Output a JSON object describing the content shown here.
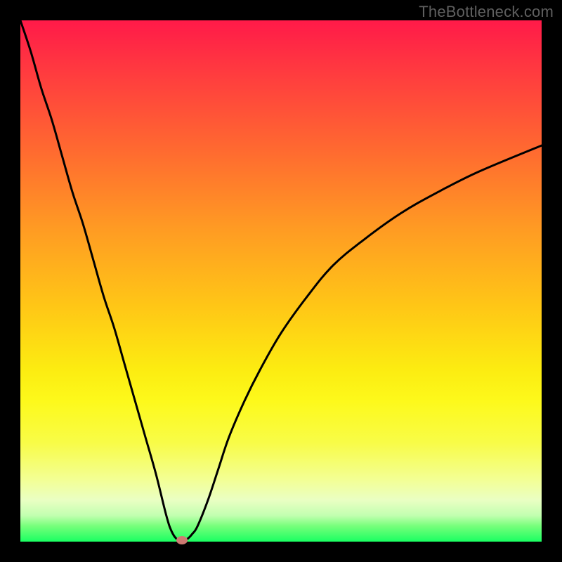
{
  "watermark": "TheBottleneck.com",
  "chart_data": {
    "type": "line",
    "title": "",
    "xlabel": "",
    "ylabel": "",
    "xlim": [
      0,
      100
    ],
    "ylim": [
      0,
      100
    ],
    "grid": false,
    "series": [
      {
        "name": "bottleneck-curve",
        "x": [
          0,
          2,
          4,
          6,
          8,
          10,
          12,
          14,
          16,
          18,
          20,
          22,
          24,
          26,
          28,
          29,
          30,
          31,
          32,
          33,
          34,
          36,
          38,
          40,
          43,
          46,
          50,
          55,
          60,
          66,
          73,
          80,
          88,
          100
        ],
        "values": [
          100,
          94,
          87,
          81,
          74,
          67,
          61,
          54,
          47,
          41,
          34,
          27,
          20,
          13,
          5,
          2,
          0.5,
          0.3,
          0.5,
          1.5,
          3,
          8,
          14,
          20,
          27,
          33,
          40,
          47,
          53,
          58,
          63,
          67,
          71,
          76
        ]
      }
    ],
    "marker": {
      "x": 31,
      "y": 0.3,
      "color": "#cd7a72"
    },
    "background": {
      "type": "vertical-gradient",
      "stops": [
        {
          "pos": 0,
          "color": "#ff1a49"
        },
        {
          "pos": 40,
          "color": "#ff9b23"
        },
        {
          "pos": 67,
          "color": "#fcec11"
        },
        {
          "pos": 92,
          "color": "#eaffc3"
        },
        {
          "pos": 100,
          "color": "#1aff62"
        }
      ]
    },
    "colors": {
      "curve": "#000000",
      "frame": "#000000"
    }
  }
}
